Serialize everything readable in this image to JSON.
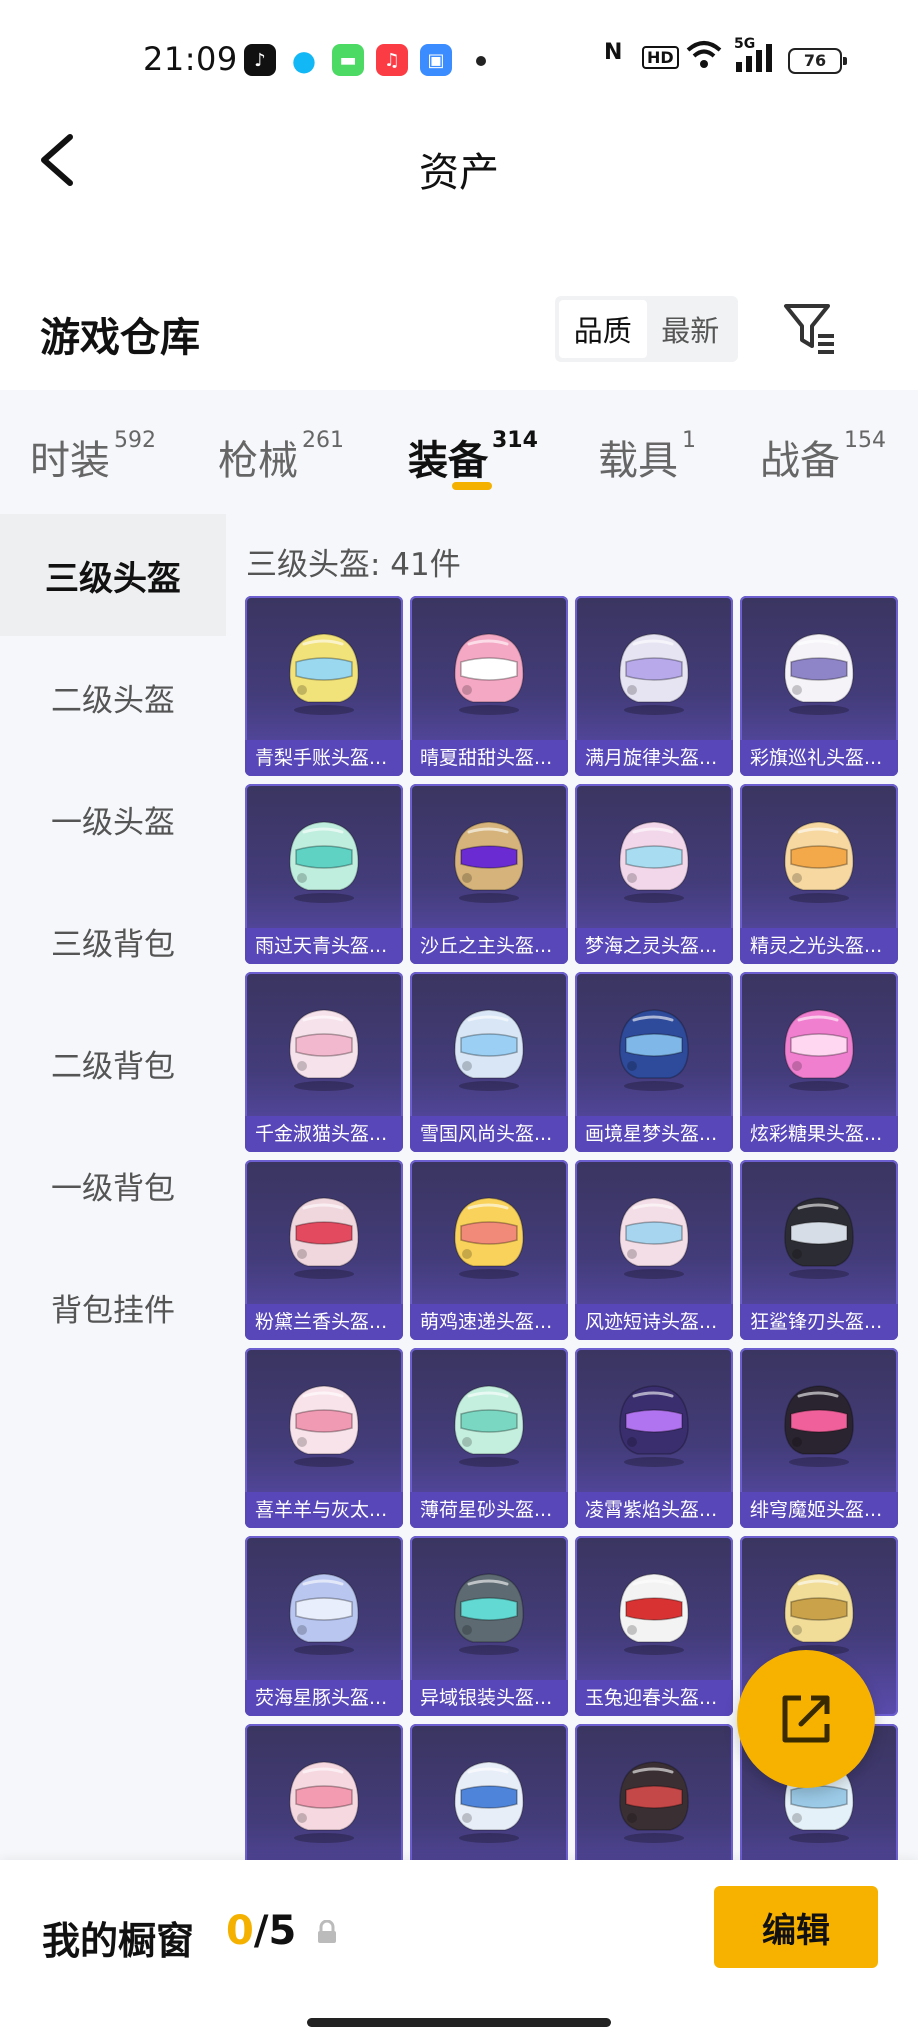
{
  "status_bar": {
    "time": "21:09",
    "battery": "76",
    "network": "5G"
  },
  "header": {
    "title": "资产"
  },
  "section": {
    "title": "游戏仓库",
    "sort_options": [
      "品质",
      "最新"
    ],
    "active_sort": "品质"
  },
  "tabs": [
    {
      "label": "时装",
      "count": "592"
    },
    {
      "label": "枪械",
      "count": "261"
    },
    {
      "label": "装备",
      "count": "314"
    },
    {
      "label": "载具",
      "count": "1"
    },
    {
      "label": "战备",
      "count": "154"
    }
  ],
  "sidebar": {
    "items": [
      "三级头盔",
      "二级头盔",
      "一级头盔",
      "三级背包",
      "二级背包",
      "一级背包",
      "背包挂件"
    ]
  },
  "list": {
    "heading": "三级头盔: 41件",
    "items": [
      {
        "label": "青梨手账头盔...",
        "color": "#f2e27a",
        "visor": "#9ad8f0"
      },
      {
        "label": "晴夏甜甜头盔...",
        "color": "#f4a8c4",
        "visor": "#ffffff"
      },
      {
        "label": "满月旋律头盔...",
        "color": "#e6e3f2",
        "visor": "#b7a9ea"
      },
      {
        "label": "彩旗巡礼头盔...",
        "color": "#f6f3f8",
        "visor": "#8e84c8"
      },
      {
        "label": "雨过天青头盔...",
        "color": "#bfeede",
        "visor": "#5fd2c4"
      },
      {
        "label": "沙丘之主头盔...",
        "color": "#d5b37a",
        "visor": "#6a2bd3"
      },
      {
        "label": "梦海之灵头盔...",
        "color": "#f2d7ea",
        "visor": "#a8dcf0"
      },
      {
        "label": "精灵之光头盔...",
        "color": "#f6d8a0",
        "visor": "#f3a94a"
      },
      {
        "label": "千金淑猫头盔...",
        "color": "#f6e2ea",
        "visor": "#f2b8cd"
      },
      {
        "label": "雪国风尚头盔...",
        "color": "#d8e6f6",
        "visor": "#9bd0f4"
      },
      {
        "label": "画境星梦头盔...",
        "color": "#2e4a9a",
        "visor": "#7fb8e8"
      },
      {
        "label": "炫彩糖果头盔...",
        "color": "#f07fcf",
        "visor": "#ffd7f1"
      },
      {
        "label": "粉黛兰香头盔...",
        "color": "#f0d7de",
        "visor": "#e34a5f"
      },
      {
        "label": "萌鸡速递头盔...",
        "color": "#f8d25a",
        "visor": "#f28a7a"
      },
      {
        "label": "风迹短诗头盔...",
        "color": "#f3dde6",
        "visor": "#a7d4ee"
      },
      {
        "label": "狂鲨锋刃头盔...",
        "color": "#2c2c34",
        "visor": "#d7dde6"
      },
      {
        "label": "喜羊羊与灰太...",
        "color": "#f8e3ea",
        "visor": "#f19ab4"
      },
      {
        "label": "薄荷星砂头盔...",
        "color": "#c4efdf",
        "visor": "#7ad8c2"
      },
      {
        "label": "凌霄紫焰头盔...",
        "color": "#3a2e6e",
        "visor": "#b174f0"
      },
      {
        "label": "绯穹魔姬头盔...",
        "color": "#2a2430",
        "visor": "#f0609a"
      },
      {
        "label": "荧海星豚头盔...",
        "color": "#b9c6f0",
        "visor": "#e9eefc"
      },
      {
        "label": "异域银装头盔...",
        "color": "#5d6a72",
        "visor": "#62d9d2"
      },
      {
        "label": "玉兔迎春头盔...",
        "color": "#f3f3f3",
        "visor": "#d93232"
      },
      {
        "label": "",
        "color": "#f1dc98",
        "visor": "#c9a24a"
      },
      {
        "label": "",
        "color": "#f6d8e0",
        "visor": "#f39bb1"
      },
      {
        "label": "",
        "color": "#e8eef8",
        "visor": "#4e84d9"
      },
      {
        "label": "",
        "color": "#3a3034",
        "visor": "#c44848"
      },
      {
        "label": "",
        "color": "#e4f1f8",
        "visor": "#9ccbe8"
      }
    ]
  },
  "bottom_bar": {
    "label": "我的橱窗",
    "current": "0",
    "total": "/5",
    "edit_label": "编辑"
  },
  "colors": {
    "accent": "#f7b200",
    "card_bg": "#433c7a",
    "card_label_bg": "#5847b8"
  }
}
